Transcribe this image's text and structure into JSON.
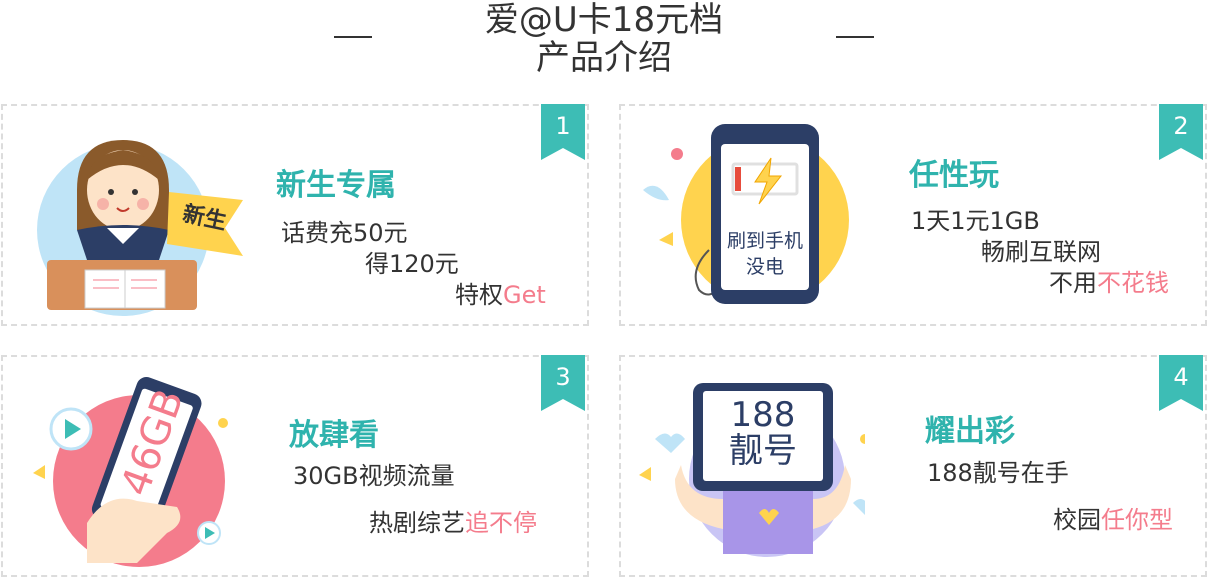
{
  "header": {
    "title_line1": "爱@U卡18元档",
    "title_line2": "产品介绍"
  },
  "cards": [
    {
      "number": "1",
      "heading": "新生专属",
      "line1": "话费充50元",
      "line2": "得120元",
      "line3_plain": "特权",
      "line3_highlight": "Get",
      "illus_tag": "新生"
    },
    {
      "number": "2",
      "heading": "任性玩",
      "line1": "1天1元1GB",
      "line2": "畅刷互联网",
      "line3_plain": "不用",
      "line3_highlight": "不花钱",
      "illus_phone_line1": "刷到手机",
      "illus_phone_line2": "没电"
    },
    {
      "number": "3",
      "heading": "放肆看",
      "line1": "30GB视频流量",
      "line2_plain": "热剧综艺",
      "line2_highlight": "追不停",
      "illus_phone_text": "46GB"
    },
    {
      "number": "4",
      "heading": "耀出彩",
      "line1": "188靓号在手",
      "line2_plain": "校园",
      "line2_highlight": "任你型",
      "illus_tablet_line1": "188",
      "illus_tablet_line2": "靓号"
    }
  ],
  "colors": {
    "teal": "#2fb3ad",
    "pink": "#f47c8c",
    "badge": "#3dbdb5",
    "yellow": "#ffd34e",
    "light_blue": "#bfe4f7",
    "navy": "#2c3e66"
  }
}
